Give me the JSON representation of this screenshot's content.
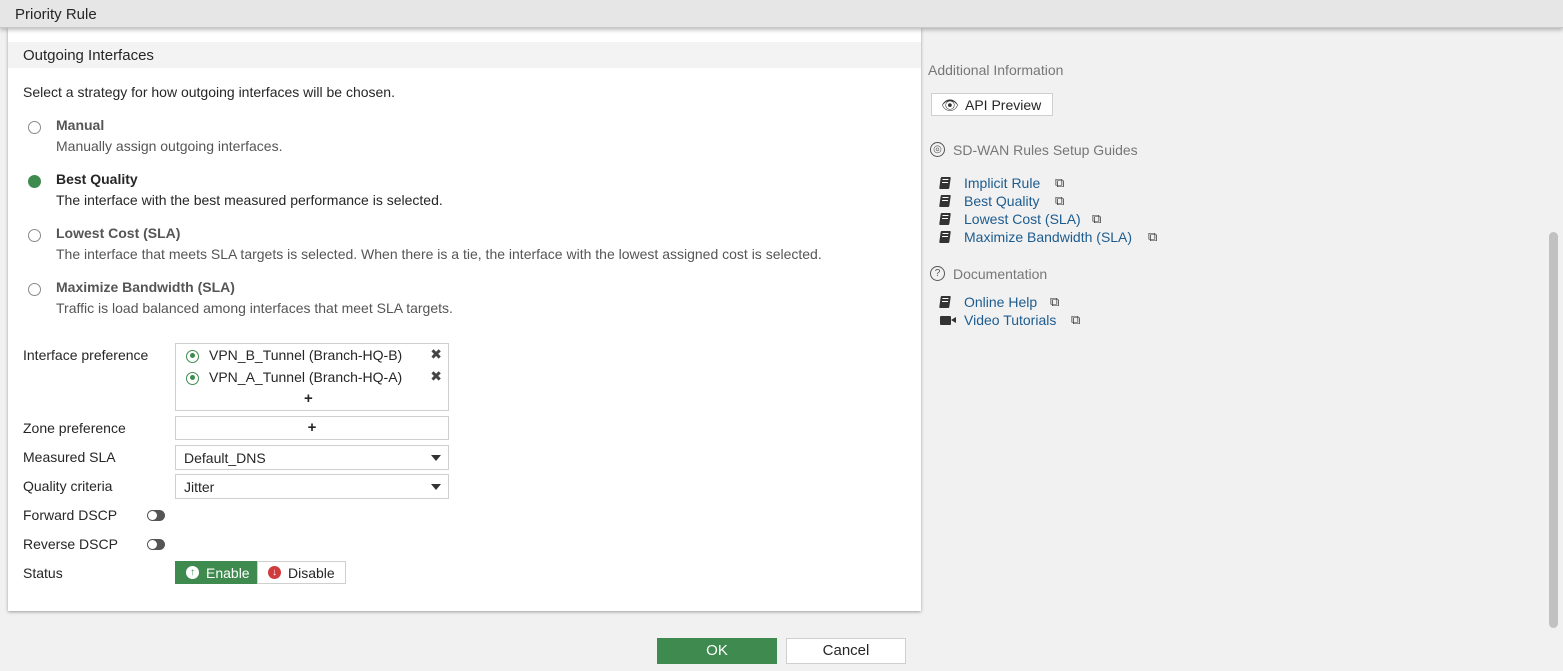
{
  "window": {
    "title": "Priority Rule"
  },
  "section": {
    "title": "Outgoing Interfaces",
    "intro": "Select a strategy for how outgoing interfaces will be chosen."
  },
  "strategies": [
    {
      "title": "Manual",
      "desc": "Manually assign outgoing interfaces.",
      "selected": false
    },
    {
      "title": "Best Quality",
      "desc": "The interface with the best measured performance is selected.",
      "selected": true
    },
    {
      "title": "Lowest Cost (SLA)",
      "desc": "The interface that meets SLA targets is selected. When there is a tie, the interface with the lowest assigned cost is selected.",
      "selected": false
    },
    {
      "title": "Maximize Bandwidth (SLA)",
      "desc": "Traffic is load balanced among interfaces that meet SLA targets.",
      "selected": false
    }
  ],
  "fields": {
    "interface_preference": {
      "label": "Interface preference",
      "items": [
        "VPN_B_Tunnel (Branch-HQ-B)",
        "VPN_A_Tunnel (Branch-HQ-A)"
      ],
      "remove_symbol": "✖",
      "add_symbol": "+"
    },
    "zone_preference": {
      "label": "Zone preference",
      "add_symbol": "+"
    },
    "measured_sla": {
      "label": "Measured SLA",
      "value": "Default_DNS"
    },
    "quality_criteria": {
      "label": "Quality criteria",
      "value": "Jitter"
    },
    "forward_dscp": {
      "label": "Forward DSCP",
      "enabled": false
    },
    "reverse_dscp": {
      "label": "Reverse DSCP",
      "enabled": false
    },
    "status": {
      "label": "Status",
      "enable_label": "Enable",
      "disable_label": "Disable",
      "selected": "Enable"
    }
  },
  "sidebar": {
    "additional_info": "Additional Information",
    "api_preview": "API Preview",
    "guides_title": "SD-WAN Rules Setup Guides",
    "guides": [
      "Implicit Rule",
      "Best Quality",
      "Lowest Cost (SLA)",
      "Maximize Bandwidth (SLA)"
    ],
    "documentation_title": "Documentation",
    "docs": [
      {
        "label": "Online Help",
        "icon": "book-icon"
      },
      {
        "label": "Video Tutorials",
        "icon": "video-icon"
      }
    ]
  },
  "footer": {
    "ok": "OK",
    "cancel": "Cancel"
  },
  "colors": {
    "accent": "#3f8b4f",
    "link": "#1d5c8f",
    "danger": "#d03b3b"
  }
}
